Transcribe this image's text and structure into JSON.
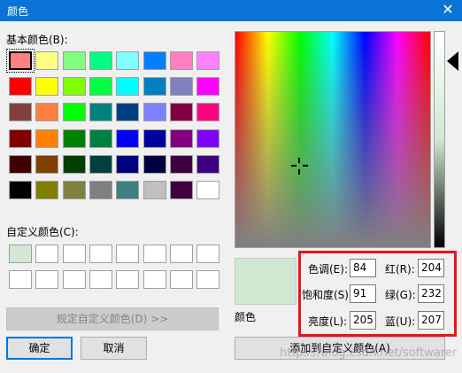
{
  "window": {
    "title": "颜色",
    "close_glyph": "✕"
  },
  "basic_colors": {
    "label": "基本颜色(B):",
    "rows": [
      [
        "#ff8080",
        "#ffff80",
        "#80ff80",
        "#00ff80",
        "#80ffff",
        "#0080ff",
        "#ff80c0",
        "#ff80ff"
      ],
      [
        "#ff0000",
        "#ffff00",
        "#80ff00",
        "#00ff40",
        "#00ffff",
        "#0080c0",
        "#8080c0",
        "#ff00ff"
      ],
      [
        "#804040",
        "#ff8040",
        "#00ff00",
        "#008080",
        "#004080",
        "#8080ff",
        "#800040",
        "#ff0080"
      ],
      [
        "#800000",
        "#ff8000",
        "#008000",
        "#008040",
        "#0000ff",
        "#0000a0",
        "#800080",
        "#8000ff"
      ],
      [
        "#400000",
        "#804000",
        "#004000",
        "#004040",
        "#000080",
        "#000040",
        "#400040",
        "#400080"
      ],
      [
        "#000000",
        "#808000",
        "#808040",
        "#808080",
        "#408080",
        "#c0c0c0",
        "#400040",
        "#ffffff"
      ]
    ]
  },
  "custom_colors": {
    "label": "自定义颜色(C):",
    "rows": [
      [
        "#d4e8d6",
        "#ffffff",
        "#ffffff",
        "#ffffff",
        "#ffffff",
        "#ffffff",
        "#ffffff",
        "#ffffff"
      ],
      [
        "#ffffff",
        "#ffffff",
        "#ffffff",
        "#ffffff",
        "#ffffff",
        "#ffffff",
        "#ffffff",
        "#ffffff"
      ]
    ]
  },
  "buttons": {
    "define_custom": "规定自定义颜色(D) >>",
    "ok": "确定",
    "cancel": "取消",
    "add_custom": "添加到自定义颜色(A)"
  },
  "preview": {
    "label": "颜色",
    "color": "#cfe8d2"
  },
  "fields": {
    "hue": {
      "label": "色调(E):",
      "value": "84"
    },
    "sat": {
      "label": "饱和度(S):",
      "value": "91"
    },
    "lum": {
      "label": "亮度(L):",
      "value": "205"
    },
    "red": {
      "label": "红(R):",
      "value": "204"
    },
    "green": {
      "label": "绿(G):",
      "value": "232"
    },
    "blue": {
      "label": "蓝(U):",
      "value": "207"
    }
  },
  "watermark": "https://blog.csdn.net/softwarer"
}
